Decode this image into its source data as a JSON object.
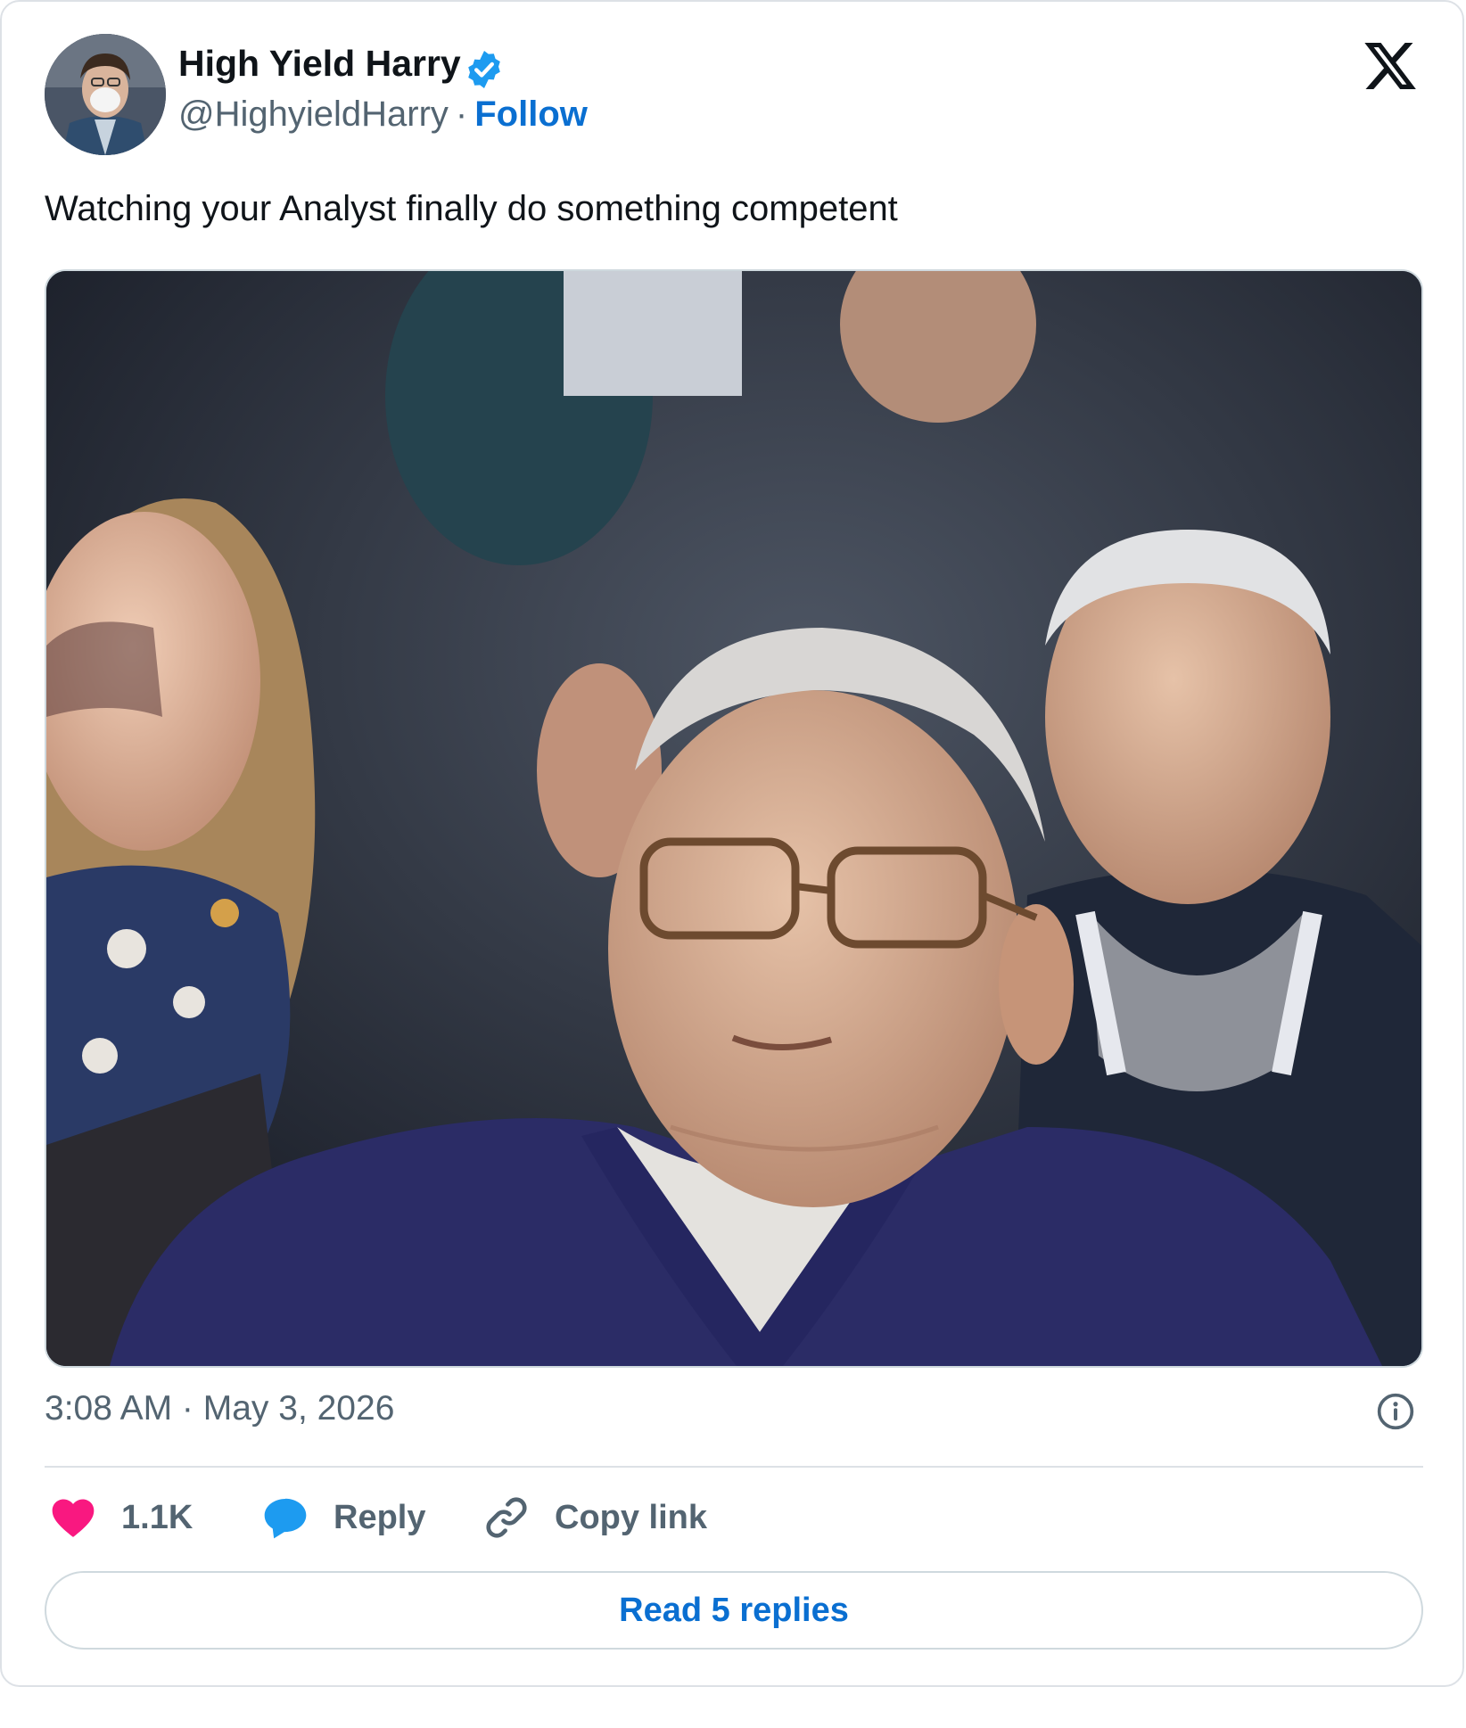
{
  "author": {
    "name": "High Yield Harry",
    "handle": "@HighyieldHarry",
    "separator": "·",
    "follow_label": "Follow",
    "verified_icon": "verified-badge-icon",
    "verified_color": "#1d9bf0"
  },
  "tweet": {
    "text": "Watching your Analyst finally do something competent",
    "timestamp": "3:08 AM · May 3, 2026"
  },
  "actions": {
    "likes_count": "1.1K",
    "reply_label": "Reply",
    "copy_label": "Copy link",
    "read_replies_label": "Read 5 replies"
  },
  "colors": {
    "link_blue": "#0a6fd1",
    "like_pink": "#f91880",
    "reply_blue": "#1d9bf0",
    "muted_text": "#536471"
  }
}
